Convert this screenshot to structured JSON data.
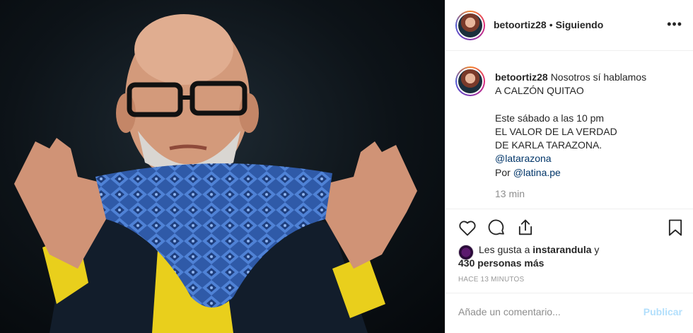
{
  "post": {
    "username": "betoortiz28",
    "follow_status": "Siguiendo",
    "dot_separator": "•",
    "more_icon": "more-options-icon"
  },
  "caption": {
    "username": "betoortiz28",
    "lines": [
      "Nosotros sí hablamos",
      "A CALZÓN QUITAO",
      "",
      "Este sábado a las 10 pm",
      "EL VALOR DE LA VERDAD",
      "DE KARLA TARAZONA.",
      "@latarazona",
      "Por",
      "@latina.pe"
    ],
    "time": "13 min"
  },
  "actions": {
    "icons": [
      "heart-icon",
      "comment-icon",
      "share-icon",
      "bookmark-icon"
    ]
  },
  "likes": {
    "prefix": "Les gusta a",
    "liker": "instarandula",
    "conjunction": "y",
    "others": "430 personas más"
  },
  "timestamp": "Hace 13 minutos",
  "comment": {
    "placeholder": "Añade un comentario...",
    "publish_label": "Publicar"
  },
  "colors": {
    "link": "#003569",
    "publish_disabled": "#b2dffc",
    "muted": "#8e8e8e"
  }
}
